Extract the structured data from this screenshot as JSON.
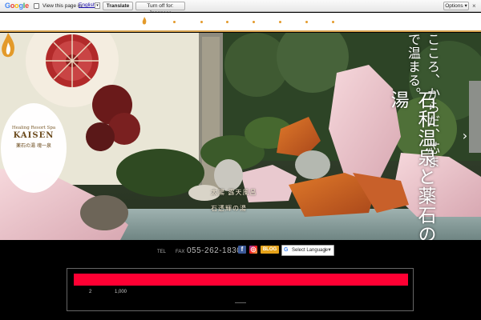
{
  "translate_bar": {
    "logo": "Google",
    "view_text": "View this page in:",
    "language": "English",
    "translate_button": "Translate",
    "turn_off_button": "Turn off for: Japanese",
    "options_button": "Options ▾",
    "close": "×"
  },
  "header": {
    "flame_icon": "flame-icon"
  },
  "hero": {
    "logo": {
      "subtitle": "Healing Resort Spa",
      "name": "KAISEN",
      "japanese": "薬石の湯 魂一泉"
    },
    "catch_small": "こころ、からだ、芯まで温まる。",
    "catch_large": "石和温泉と薬石の湯",
    "plate_line1": "太陽 露天風呂",
    "plate_line2": "石透輝の湯",
    "next_arrow": "›"
  },
  "contact": {
    "label1": "TEL",
    "label2": "FAX",
    "phone": "055-262-1830",
    "facebook": "f",
    "instagram": "◎",
    "blog": "BLOG",
    "language_select": "Select Language"
  },
  "info": {
    "item_a": "2",
    "item_b": "1,000"
  },
  "colors": {
    "accent_orange": "#e39a2a",
    "red_bar": "#ff0033"
  }
}
